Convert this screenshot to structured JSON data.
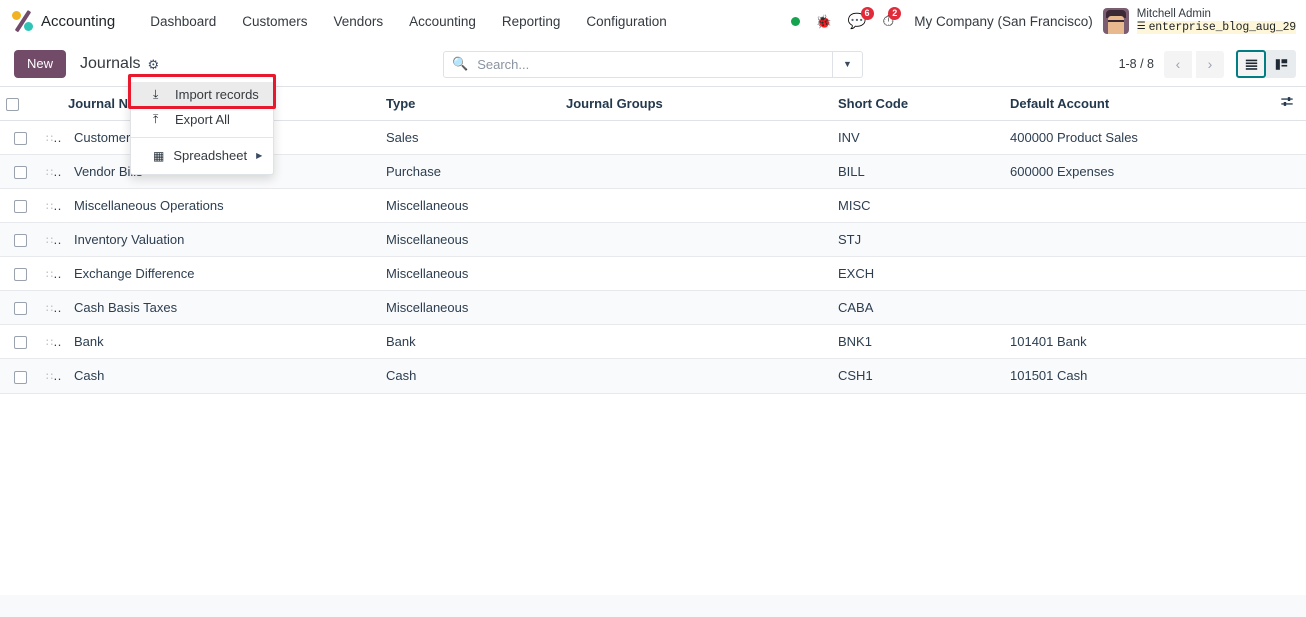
{
  "navbar": {
    "app_icon": "accounting-app-icon",
    "app_name": "Accounting",
    "menu": [
      {
        "label": "Dashboard"
      },
      {
        "label": "Customers"
      },
      {
        "label": "Vendors"
      },
      {
        "label": "Accounting"
      },
      {
        "label": "Reporting"
      },
      {
        "label": "Configuration"
      }
    ],
    "status_dot": {
      "icon": "online-status-dot",
      "color": "#14a44d"
    },
    "debug_icon": {
      "icon": "bug-icon",
      "glyph": "🐞"
    },
    "messages": {
      "icon": "chat-bubble-icon",
      "glyph": "💬",
      "count": "6"
    },
    "activities": {
      "icon": "clock-icon",
      "glyph": "⏱",
      "count": "2"
    },
    "company": "My Company (San Francisco)",
    "user": {
      "avatar": "user-avatar",
      "name": "Mitchell Admin",
      "database_icon": "database-icon",
      "database": "enterprise_blog_aug_29"
    }
  },
  "control_panel": {
    "new_label": "New",
    "breadcrumb": "Journals",
    "gear_icon": "gear-icon",
    "search": {
      "icon": "search-icon",
      "placeholder": "Search...",
      "value": "",
      "toggle_icon": "chevron-down-icon"
    },
    "pager": {
      "count": "1-8 / 8",
      "prev_icon": "chevron-left-icon",
      "next_icon": "chevron-right-icon"
    },
    "views": [
      {
        "name": "list-view",
        "icon": "list-icon",
        "active": true
      },
      {
        "name": "kanban-view",
        "icon": "kanban-icon",
        "active": false
      }
    ]
  },
  "dropdown": {
    "items": [
      {
        "label": "Import records",
        "icon": "import-icon",
        "highlighted": true
      },
      {
        "label": "Export All",
        "icon": "export-icon",
        "highlighted": false
      },
      {
        "label": "Spreadsheet",
        "icon": "spreadsheet-icon",
        "highlighted": false,
        "has_submenu": true
      }
    ],
    "highlight_color": "#e8192c"
  },
  "table": {
    "headers": {
      "select": "",
      "handle": "",
      "name": "Journal Name",
      "type": "Type",
      "groups": "Journal Groups",
      "short_code": "Short Code",
      "default_account": "Default Account",
      "options_icon": "column-options-icon"
    },
    "rows": [
      {
        "name": "Customer Invoices",
        "type": "Sales",
        "groups": "",
        "short_code": "INV",
        "default_account": "400000 Product Sales"
      },
      {
        "name": "Vendor Bills",
        "type": "Purchase",
        "groups": "",
        "short_code": "BILL",
        "default_account": "600000 Expenses"
      },
      {
        "name": "Miscellaneous Operations",
        "type": "Miscellaneous",
        "groups": "",
        "short_code": "MISC",
        "default_account": ""
      },
      {
        "name": "Inventory Valuation",
        "type": "Miscellaneous",
        "groups": "",
        "short_code": "STJ",
        "default_account": ""
      },
      {
        "name": "Exchange Difference",
        "type": "Miscellaneous",
        "groups": "",
        "short_code": "EXCH",
        "default_account": ""
      },
      {
        "name": "Cash Basis Taxes",
        "type": "Miscellaneous",
        "groups": "",
        "short_code": "CABA",
        "default_account": ""
      },
      {
        "name": "Bank",
        "type": "Bank",
        "groups": "",
        "short_code": "BNK1",
        "default_account": "101401 Bank"
      },
      {
        "name": "Cash",
        "type": "Cash",
        "groups": "",
        "short_code": "CSH1",
        "default_account": "101501 Cash"
      }
    ]
  }
}
